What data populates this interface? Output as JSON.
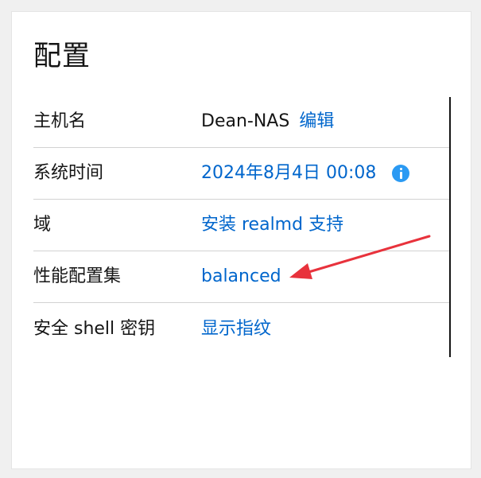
{
  "card": {
    "title": "配置"
  },
  "rows": [
    {
      "label": "主机名",
      "value": "Dean-NAS",
      "action": "编辑"
    },
    {
      "label": "系统时间",
      "value": "2024年8月4日 00:08",
      "icon": "info-icon"
    },
    {
      "label": "域",
      "value": "安装 realmd 支持"
    },
    {
      "label": "性能配置集",
      "value": "balanced"
    },
    {
      "label": "安全 shell 密钥",
      "value": "显示指纹"
    }
  ],
  "colors": {
    "link": "#0066cc",
    "info": "#2b9af3",
    "annotation_arrow": "#e8323c"
  }
}
